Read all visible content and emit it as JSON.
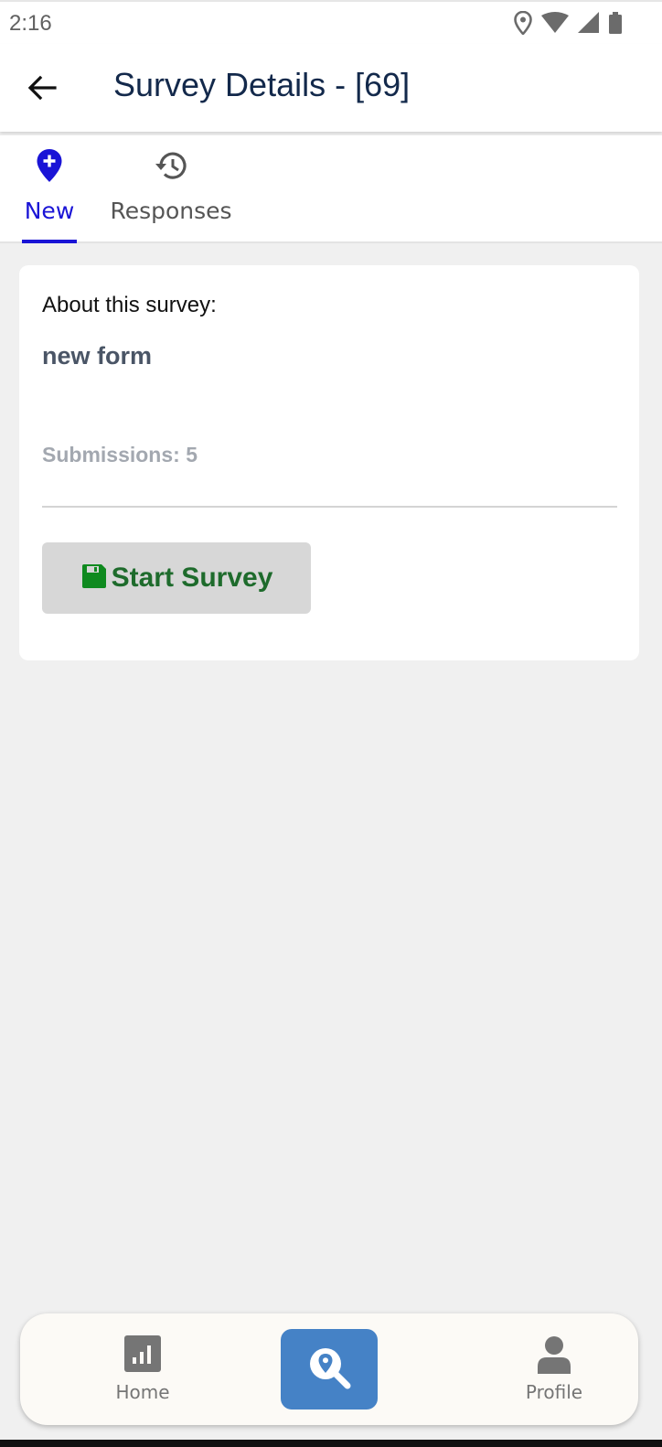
{
  "status_bar": {
    "time": "2:16",
    "icons": [
      "location-icon",
      "wifi-icon",
      "signal-icon",
      "battery-icon"
    ]
  },
  "app_bar": {
    "back_icon": "arrow-left-icon",
    "title": "Survey Details - [69]"
  },
  "tabs": [
    {
      "label": "New",
      "icon": "map-pin-plus-icon",
      "active": true
    },
    {
      "label": "Responses",
      "icon": "history-icon",
      "active": false
    }
  ],
  "card": {
    "about_label": "About this survey:",
    "survey_name": "new form",
    "submissions": "Submissions: 5",
    "start_button_label": "Start Survey",
    "start_button_icon": "save-icon"
  },
  "bottom_nav": {
    "items": [
      {
        "label": "Home",
        "icon": "chart-icon"
      },
      {
        "label": "",
        "icon": "location-search-icon",
        "active": true
      },
      {
        "label": "Profile",
        "icon": "user-icon"
      }
    ]
  },
  "colors": {
    "accent": "#1a14d6",
    "title": "#13294b",
    "start_button_text": "#1e6b2c",
    "save_icon": "#0f8a1f",
    "nav_active_bg": "#4582c6"
  }
}
